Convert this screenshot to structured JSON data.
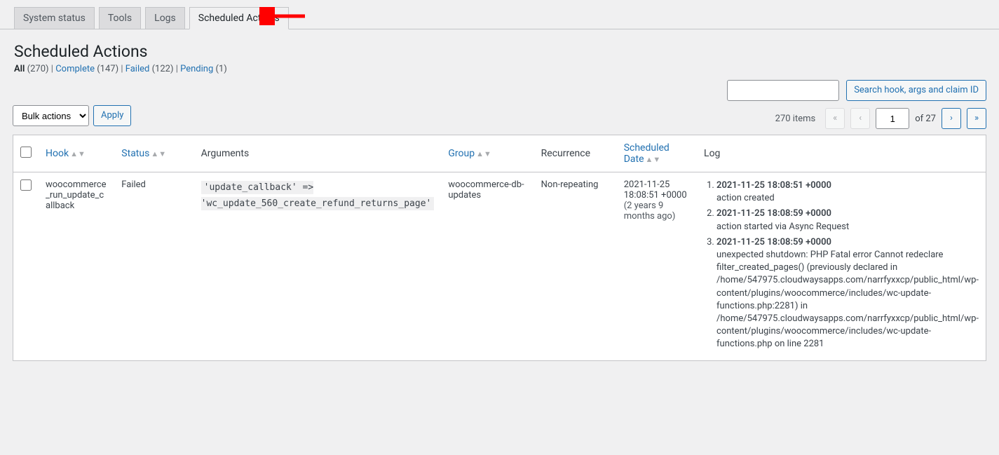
{
  "tabs": [
    {
      "label": "System status"
    },
    {
      "label": "Tools"
    },
    {
      "label": "Logs"
    },
    {
      "label": "Scheduled Actions"
    }
  ],
  "page": {
    "title": "Scheduled Actions"
  },
  "filters": {
    "all_label": "All",
    "all_count": "(270)",
    "complete_label": "Complete",
    "complete_count": "(147)",
    "failed_label": "Failed",
    "failed_count": "(122)",
    "pending_label": "Pending",
    "pending_count": "(1)"
  },
  "bulk": {
    "select_label": "Bulk actions",
    "apply_label": "Apply"
  },
  "search": {
    "button_label": "Search hook, args and claim ID"
  },
  "pagination": {
    "items_label": "270 items",
    "current_page": "1",
    "total_pages_label": "of 27",
    "first": "«",
    "prev": "‹",
    "next": "›",
    "last": "»"
  },
  "columns": {
    "hook": "Hook",
    "status": "Status",
    "arguments": "Arguments",
    "group": "Group",
    "recurrence": "Recurrence",
    "scheduled": "Scheduled Date",
    "log": "Log"
  },
  "row": {
    "hook": "woocommerce_run_update_callback",
    "status": "Failed",
    "arguments": "'update_callback' => 'wc_update_560_create_refund_returns_page'",
    "group": "woocommerce-db-updates",
    "recurrence": "Non-repeating",
    "scheduled_date": "2021-11-25 18:08:51 +0000",
    "scheduled_ago": "(2 years 9 months ago)",
    "logs": [
      {
        "ts": "2021-11-25 18:08:51 +0000",
        "msg": "action created"
      },
      {
        "ts": "2021-11-25 18:08:59 +0000",
        "msg": "action started via Async Request"
      },
      {
        "ts": "2021-11-25 18:08:59 +0000",
        "msg": "unexpected shutdown: PHP Fatal error Cannot redeclare filter_created_pages() (previously declared in /home/547975.cloudwaysapps.com/narrfyxxcp/public_html/wp-content/plugins/woocommerce/includes/wc-update-functions.php:2281) in /home/547975.cloudwaysapps.com/narrfyxxcp/public_html/wp-content/plugins/woocommerce/includes/wc-update-functions.php on line 2281"
      }
    ]
  }
}
